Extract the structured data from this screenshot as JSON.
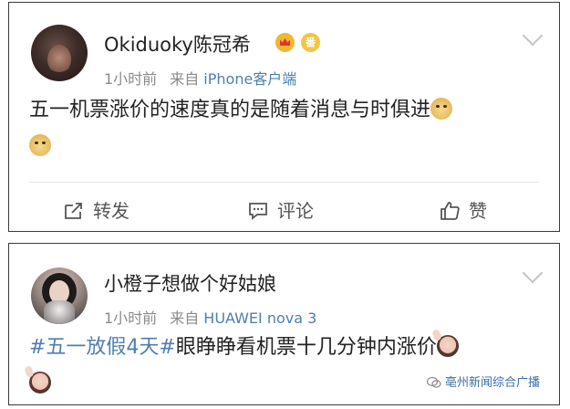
{
  "posts": [
    {
      "username": "Okiduoky陈冠希",
      "badge_vip": "番",
      "time": "1小时前",
      "source_prefix": "来自",
      "source": "iPhone客户端",
      "text": "五一机票涨价的速度真的是随着消息与时俱进",
      "emojis": [
        "doge",
        "doge"
      ],
      "actions": {
        "forward": "转发",
        "comment": "评论",
        "like": "赞"
      }
    },
    {
      "username": "小橙子想做个好姑娘",
      "time": "1小时前",
      "source_prefix": "来自",
      "source": "HUAWEI nova 3",
      "hashtag": "#五一放假4天#",
      "text": "眼睁睁看机票十几分钟内涨价",
      "emojis": [
        "girl-raising-hand",
        "girl-raising-hand"
      ]
    }
  ],
  "watermark": "亳州新闻综合广播",
  "colors": {
    "link": "#4e7fb0",
    "meta": "#8a8a8a",
    "border": "#3a3a3a"
  }
}
